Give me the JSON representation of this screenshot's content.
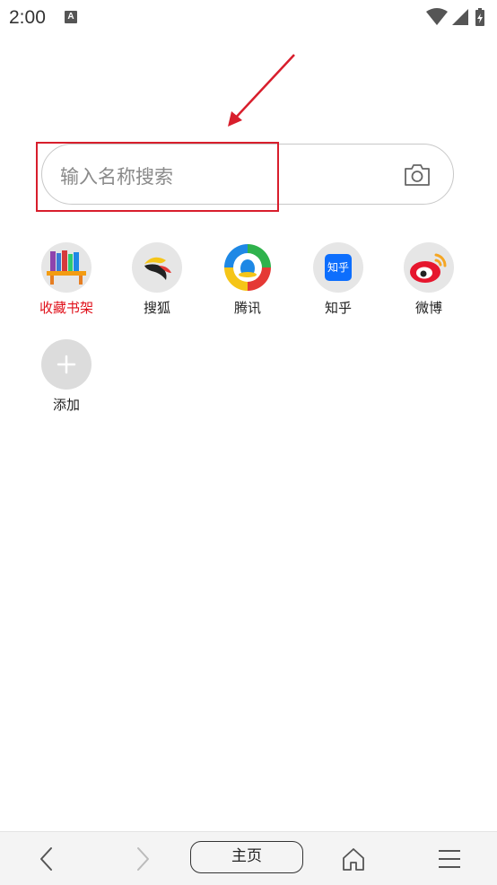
{
  "status_bar": {
    "time": "2:00",
    "notification_icon": "a-icon"
  },
  "search": {
    "placeholder": "输入名称搜索",
    "camera_icon": "camera-icon"
  },
  "shortcuts": [
    {
      "label": "收藏书架",
      "icon": "bookshelf-icon"
    },
    {
      "label": "搜狐",
      "icon": "sohu-icon"
    },
    {
      "label": "腾讯",
      "icon": "tencent-icon"
    },
    {
      "label": "知乎",
      "icon": "zhihu-icon",
      "icon_text": "知乎"
    },
    {
      "label": "微博",
      "icon": "weibo-icon"
    },
    {
      "label": "添加",
      "icon": "plus-icon"
    }
  ],
  "bottom_nav": {
    "home_label": "主页"
  },
  "colors": {
    "accent_red": "#e0101a",
    "annotation_red": "#d81e2c",
    "zhihu_blue": "#0d6efd"
  }
}
